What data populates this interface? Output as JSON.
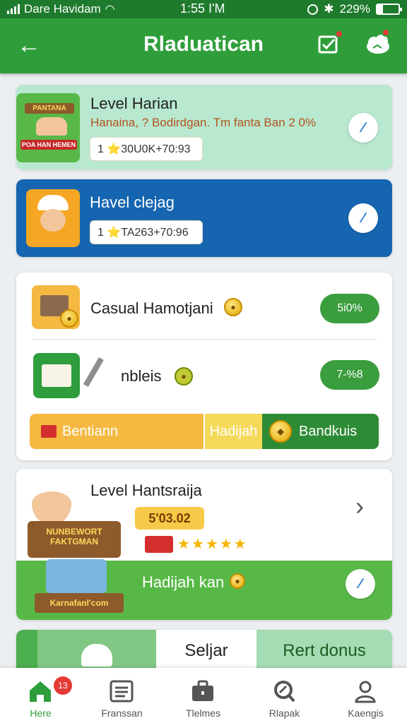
{
  "status_bar": {
    "carrier": "Dare Havidam",
    "time": "1:55 I'M",
    "battery": "229%"
  },
  "app_bar": {
    "title": "Rladuatican"
  },
  "cards": [
    {
      "title": "Level Harian",
      "subtitle": "Hanaina, ? Bodirdgan. Tm fanta Ban 2 0%",
      "pill": "1 ⭐30U0K+70:93",
      "thumb_sign_top": "PANTANA",
      "thumb_sign_bottom": "POA HAN HEMEN"
    },
    {
      "title": "Havel clejag",
      "pill": "1 ⭐TA263+70:96"
    }
  ],
  "offers": {
    "row1": {
      "label": "Casual Hamotjani",
      "button": "5i0%"
    },
    "row2": {
      "label": "nbleis",
      "button": "7-%8"
    },
    "split_left": "Bentiann",
    "split_mid": "Hadijah",
    "split_right": "Bandkuis"
  },
  "level_card": {
    "title": "Level Hantsraija",
    "price": "5'03.02",
    "sign_top": "NUNBEWORT FAKTGMAN",
    "sign_bottom": "Karnafanl'com",
    "reward": "Hadijah kan"
  },
  "bottom_tabs_row": {
    "center": "Seljar",
    "right": "Rert donus"
  },
  "tabs": [
    {
      "label": "Here",
      "badge": "13"
    },
    {
      "label": "Franssan"
    },
    {
      "label": "Tlelmes"
    },
    {
      "label": "Rlapak"
    },
    {
      "label": "Kaengis"
    }
  ],
  "colors": {
    "primary": "#2f9e3a",
    "status": "#1e7a2c",
    "blue_card": "#1565b0",
    "mint_card": "#b8e8cf",
    "orange": "#f5b941"
  }
}
